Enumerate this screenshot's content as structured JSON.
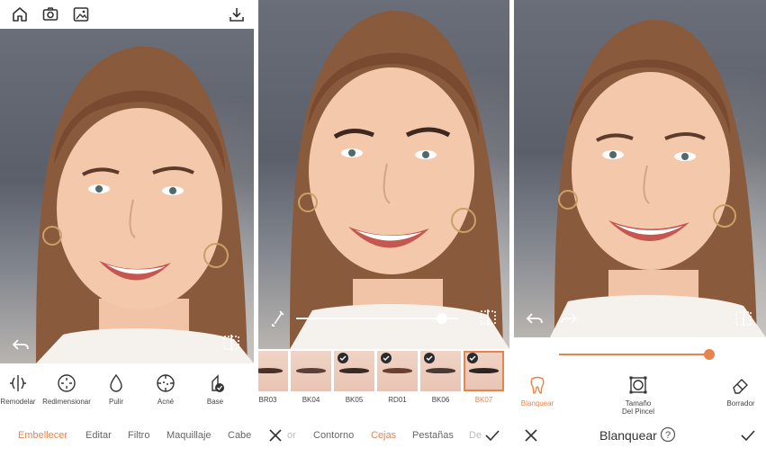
{
  "panel1": {
    "top_icons": [
      "home-icon",
      "camera-icon",
      "gallery-icon",
      "download-icon"
    ],
    "features": [
      {
        "label": "Remodelar",
        "icon": "remodel-icon"
      },
      {
        "label": "Redimensionar",
        "icon": "resize-icon"
      },
      {
        "label": "Pulir",
        "icon": "drop-icon"
      },
      {
        "label": "Acné",
        "icon": "acne-icon"
      },
      {
        "label": "Base",
        "icon": "foundation-icon"
      }
    ],
    "tabs": [
      {
        "label": "Embellecer",
        "active": true
      },
      {
        "label": "Editar",
        "active": false
      },
      {
        "label": "Filtro",
        "active": false
      },
      {
        "label": "Maquillaje",
        "active": false
      },
      {
        "label": "Cabe",
        "active": false
      }
    ]
  },
  "panel2": {
    "thumbs": [
      {
        "label": "BR03",
        "checked": false,
        "selected": false
      },
      {
        "label": "BK04",
        "checked": false,
        "selected": false
      },
      {
        "label": "BK05",
        "checked": true,
        "selected": false
      },
      {
        "label": "RD01",
        "checked": true,
        "selected": false
      },
      {
        "label": "BK06",
        "checked": true,
        "selected": false
      },
      {
        "label": "BK07",
        "checked": true,
        "selected": true
      }
    ],
    "slider_value": 0.9,
    "tabs": [
      {
        "label": "or",
        "state": "faded"
      },
      {
        "label": "Contorno",
        "state": "normal"
      },
      {
        "label": "Cejas",
        "state": "active"
      },
      {
        "label": "Pestañas",
        "state": "normal"
      },
      {
        "label": "De",
        "state": "faded"
      }
    ]
  },
  "panel3": {
    "slider_value": 0.97,
    "tools": [
      {
        "label": "Blanquear",
        "icon": "tooth-icon",
        "active": true
      },
      {
        "label": "Tamaño\nDel Pincel",
        "icon": "brush-size-icon",
        "active": false
      },
      {
        "label": "Borrador",
        "icon": "eraser-icon",
        "active": false
      }
    ],
    "title": "Blanquear",
    "help_symbol": "?"
  },
  "colors": {
    "accent": "#e8834d",
    "text": "#333333",
    "muted": "#666666"
  }
}
